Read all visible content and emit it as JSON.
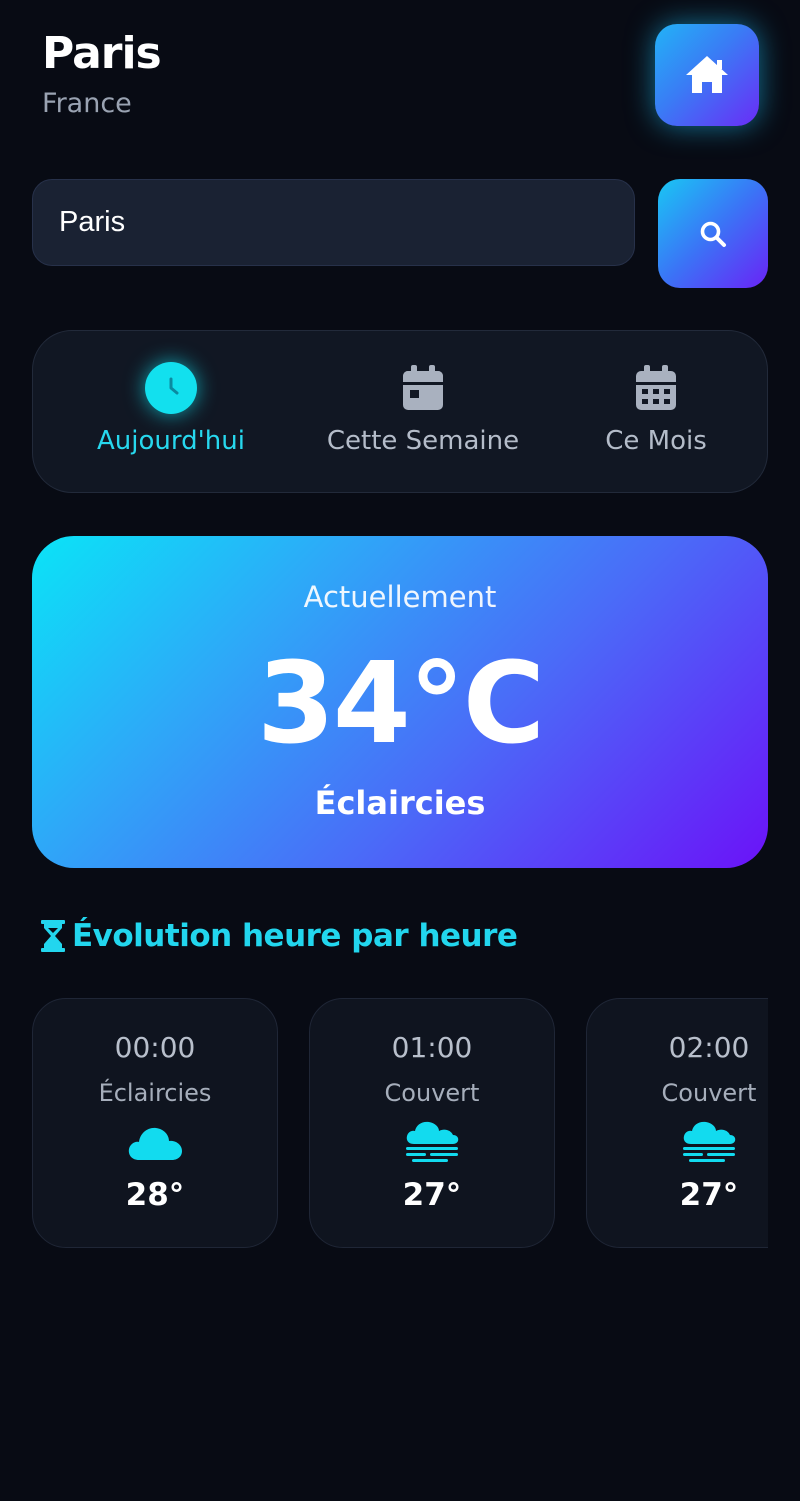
{
  "header": {
    "city": "Paris",
    "country": "France"
  },
  "search": {
    "value": "Paris",
    "placeholder": ""
  },
  "tabs": [
    {
      "label": "Aujourd'hui",
      "icon": "clock-icon",
      "active": true
    },
    {
      "label": "Cette Semaine",
      "icon": "calendar-week-icon",
      "active": false
    },
    {
      "label": "Ce Mois",
      "icon": "calendar-month-icon",
      "active": false
    }
  ],
  "current": {
    "label": "Actuellement",
    "temperature": "34°C",
    "condition": "Éclaircies"
  },
  "hourly": {
    "title": "Évolution heure par heure",
    "items": [
      {
        "time": "00:00",
        "condition": "Éclaircies",
        "temp": "28°",
        "icon": "cloud-icon"
      },
      {
        "time": "01:00",
        "condition": "Couvert",
        "temp": "27°",
        "icon": "cloud-fog-icon"
      },
      {
        "time": "02:00",
        "condition": "Couvert",
        "temp": "27°",
        "icon": "cloud-fog-icon"
      }
    ]
  },
  "colors": {
    "background": "#080b14",
    "accent": "#22d6ee",
    "gradient_start": "#0ae4f7",
    "gradient_end": "#6b12f8"
  }
}
